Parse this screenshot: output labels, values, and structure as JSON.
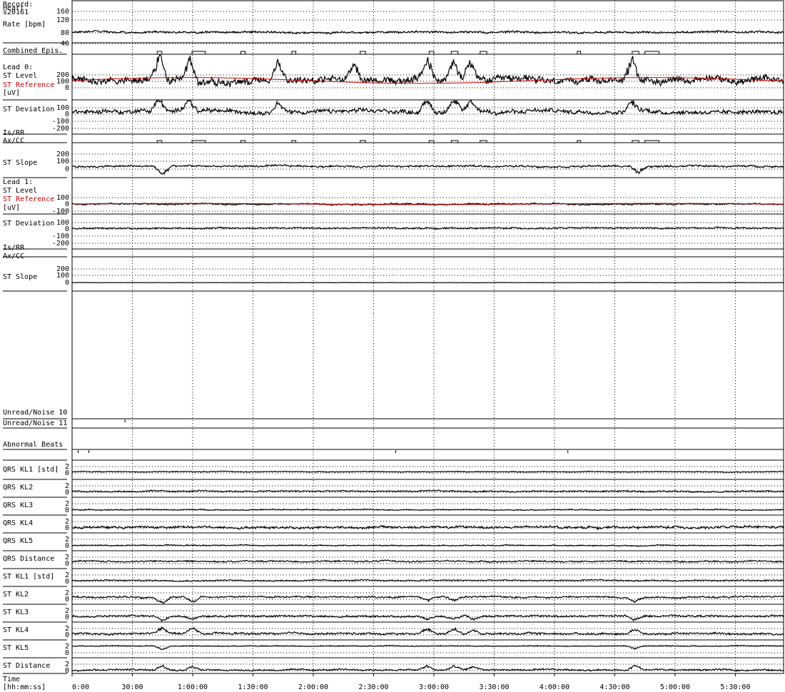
{
  "record": {
    "label": "Record:",
    "id": "s20161"
  },
  "chart_data": {
    "type": "line",
    "x_axis": {
      "label_line1": "Time",
      "label_line2": "[hh:mm:ss]",
      "range_seconds": [
        0,
        21240
      ],
      "ticks": [
        {
          "t": 0,
          "label": "0:00"
        },
        {
          "t": 1800,
          "label": "30:00"
        },
        {
          "t": 3600,
          "label": "1:00:00"
        },
        {
          "t": 5400,
          "label": "1:30:00"
        },
        {
          "t": 7200,
          "label": "2:00:00"
        },
        {
          "t": 9000,
          "label": "2:30:00"
        },
        {
          "t": 10800,
          "label": "3:00:00"
        },
        {
          "t": 12600,
          "label": "3:30:00"
        },
        {
          "t": 14400,
          "label": "4:00:00"
        },
        {
          "t": 16200,
          "label": "4:30:00"
        },
        {
          "t": 18000,
          "label": "5:00:00"
        },
        {
          "t": 19800,
          "label": "5:30:00"
        }
      ]
    },
    "panels": [
      {
        "key": "hr",
        "labels": [
          {
            "text": "Heart"
          },
          {
            "text": "Rate [bpm]"
          }
        ],
        "yticks": [
          "160",
          "120",
          "80",
          "40"
        ],
        "yrange": [
          40,
          160
        ],
        "baseline": 80,
        "amp": 6,
        "series": [
          {
            "name": "Heart Rate",
            "color": "#000000"
          }
        ]
      },
      {
        "key": "epis",
        "labels": [
          {
            "text": "Combined Epis."
          }
        ],
        "yticks": [],
        "markers": [
          [
            2540,
            2680
          ],
          [
            3580,
            3980
          ],
          [
            5040,
            5170
          ],
          [
            6560,
            6680
          ],
          [
            8600,
            8760
          ],
          [
            10660,
            10800
          ],
          [
            11320,
            11520
          ],
          [
            12180,
            12380
          ],
          [
            15080,
            15180
          ],
          [
            16720,
            16920
          ],
          [
            17100,
            17520
          ]
        ]
      },
      {
        "key": "l0level",
        "labels": [
          {
            "text": "Lead 0:"
          },
          {
            "text": "ST Level"
          },
          {
            "text": "ST Reference",
            "color": "#cc0000"
          },
          {
            "text": "[uV]"
          }
        ],
        "yticks": [
          "200",
          "100",
          "0"
        ],
        "yrange": [
          -100,
          250
        ],
        "baseline": 60,
        "amp": 45,
        "series": [
          {
            "name": "ST Level",
            "color": "#000000"
          },
          {
            "name": "ST Reference",
            "color": "#cc0000"
          }
        ],
        "spikes": [
          [
            2600,
            250
          ],
          [
            3500,
            200
          ],
          [
            6150,
            180
          ],
          [
            8400,
            170
          ],
          [
            10600,
            230
          ],
          [
            11400,
            190
          ],
          [
            11900,
            180
          ],
          [
            16700,
            220
          ]
        ]
      },
      {
        "key": "l0dev",
        "labels": [
          {
            "text": "ST Deviation"
          }
        ],
        "yticks": [
          "100",
          "0",
          "-100",
          "-200"
        ],
        "yrange": [
          -200,
          120
        ],
        "baseline": 0,
        "amp": 40,
        "series": [
          {
            "name": "ST Deviation",
            "color": "#000000"
          }
        ],
        "spikes": [
          [
            2600,
            200
          ],
          [
            3500,
            180
          ],
          [
            6150,
            140
          ],
          [
            10600,
            180
          ],
          [
            11400,
            150
          ],
          [
            11900,
            140
          ],
          [
            16700,
            160
          ]
        ]
      },
      {
        "key": "l0isrr",
        "labels": [
          {
            "text": "Is/RR"
          },
          {
            "text": "Ax/CC"
          }
        ],
        "yticks": [],
        "markers": [
          [
            2540,
            2680
          ],
          [
            3580,
            3980
          ],
          [
            5040,
            5170
          ],
          [
            6560,
            6680
          ],
          [
            8600,
            8760
          ],
          [
            10660,
            10800
          ],
          [
            11320,
            11520
          ],
          [
            12180,
            12380
          ],
          [
            15080,
            15180
          ],
          [
            16720,
            16920
          ],
          [
            17100,
            17520
          ]
        ]
      },
      {
        "key": "l0slope",
        "labels": [
          {
            "text": "ST Slope"
          }
        ],
        "yticks": [
          "200",
          "100",
          "0"
        ],
        "yrange": [
          -50,
          250
        ],
        "baseline": 80,
        "amp": 18,
        "series": [
          {
            "name": "ST Slope",
            "color": "#000000"
          }
        ],
        "spikes": [
          [
            2700,
            -120
          ],
          [
            16900,
            -100
          ]
        ]
      },
      {
        "key": "l1level",
        "labels": [
          {
            "text": "Lead 1:"
          },
          {
            "text": "ST Level"
          },
          {
            "text": "ST Reference",
            "color": "#cc0000"
          },
          {
            "text": "[uV]"
          }
        ],
        "yticks": [
          "100",
          "0",
          "-100"
        ],
        "yrange": [
          -120,
          140
        ],
        "baseline": 0,
        "amp": 18,
        "series": [
          {
            "name": "ST Level",
            "color": "#000000"
          },
          {
            "name": "ST Reference",
            "color": "#cc0000"
          }
        ]
      },
      {
        "key": "l1dev",
        "labels": [
          {
            "text": "ST Deviation"
          }
        ],
        "yticks": [
          "100",
          "0",
          "-100",
          "-200"
        ],
        "yrange": [
          -220,
          130
        ],
        "baseline": 0,
        "amp": 16,
        "series": [
          {
            "name": "ST Deviation",
            "color": "#000000"
          }
        ]
      },
      {
        "key": "l1isrr",
        "labels": [
          {
            "text": "Is/RR"
          },
          {
            "text": "Ax/CC"
          }
        ],
        "yticks": [],
        "markers": []
      },
      {
        "key": "l1slope",
        "labels": [
          {
            "text": "ST Slope"
          }
        ],
        "yticks": [
          "200",
          "100",
          "0"
        ],
        "yrange": [
          -20,
          260
        ],
        "baseline": 0,
        "amp": 3,
        "series": [
          {
            "name": "ST Slope",
            "color": "#000000"
          }
        ]
      },
      {
        "key": "empty",
        "labels": [],
        "yticks": []
      },
      {
        "key": "noise0",
        "labels": [
          {
            "text": "Unread/Noise 10"
          }
        ],
        "yticks": [],
        "ticksAt": [
          1580
        ]
      },
      {
        "key": "noise1",
        "labels": [
          {
            "text": "Unread/Noise 11"
          }
        ],
        "yticks": []
      },
      {
        "key": "abn",
        "labels": [
          {
            "text": "Abnormal Beats"
          }
        ],
        "yticks": [],
        "ticksAt": [
          180,
          500,
          9660,
          14800
        ]
      },
      {
        "key": "qkl1",
        "labels": [
          {
            "text": "QRS KL1 [std]"
          }
        ],
        "yticks": [
          "2",
          "0"
        ],
        "yrange": [
          -1,
          3
        ],
        "baseline": 0.3,
        "amp": 0.2
      },
      {
        "key": "qkl2",
        "labels": [
          {
            "text": "QRS KL2"
          }
        ],
        "yticks": [
          "2",
          "0"
        ],
        "yrange": [
          -1,
          3
        ],
        "baseline": 0.2,
        "amp": 0.35
      },
      {
        "key": "qkl3",
        "labels": [
          {
            "text": "QRS KL3"
          }
        ],
        "yticks": [
          "2",
          "0"
        ],
        "yrange": [
          -1,
          3
        ],
        "baseline": 0.0,
        "amp": 0.25
      },
      {
        "key": "qkl4",
        "labels": [
          {
            "text": "QRS KL4"
          }
        ],
        "yticks": [
          "2",
          "0"
        ],
        "yrange": [
          -1,
          3
        ],
        "baseline": 0.1,
        "amp": 0.6
      },
      {
        "key": "qkl5",
        "labels": [
          {
            "text": "QRS KL5"
          }
        ],
        "yticks": [
          "2",
          "0"
        ],
        "yrange": [
          -1,
          3
        ],
        "baseline": 0.0,
        "amp": 0.25
      },
      {
        "key": "qdist",
        "labels": [
          {
            "text": "QRS Distance"
          }
        ],
        "yticks": [
          "2",
          "0"
        ],
        "yrange": [
          -1,
          3
        ],
        "baseline": 0.6,
        "amp": 0.4
      },
      {
        "key": "skl1",
        "labels": [
          {
            "text": "ST KL1 [std]"
          }
        ],
        "yticks": [
          "2",
          "0"
        ],
        "yrange": [
          -1,
          3
        ],
        "baseline": 0.2,
        "amp": 0.3
      },
      {
        "key": "skl2",
        "labels": [
          {
            "text": "ST KL2"
          }
        ],
        "yticks": [
          "2",
          "0"
        ],
        "yrange": [
          -1,
          3
        ],
        "baseline": 0.6,
        "amp": 0.45,
        "spikes": [
          [
            2700,
            -2
          ],
          [
            3600,
            -1.8
          ],
          [
            10600,
            -1.2
          ],
          [
            11400,
            -1.3
          ],
          [
            16800,
            -1.8
          ]
        ]
      },
      {
        "key": "skl3",
        "labels": [
          {
            "text": "ST KL3"
          }
        ],
        "yticks": [
          "2",
          "0"
        ],
        "yrange": [
          -1,
          3
        ],
        "baseline": 0.2,
        "amp": 0.45,
        "spikes": [
          [
            2700,
            -1.5
          ],
          [
            3600,
            -1.2
          ],
          [
            10600,
            -1.2
          ],
          [
            11400,
            -1.3
          ],
          [
            12000,
            -1.3
          ],
          [
            16800,
            -1.5
          ]
        ]
      },
      {
        "key": "skl4",
        "labels": [
          {
            "text": "ST KL4"
          }
        ],
        "yticks": [
          "2",
          "0"
        ],
        "yrange": [
          -1,
          3
        ],
        "baseline": 0.3,
        "amp": 0.5,
        "spikes": [
          [
            2700,
            2
          ],
          [
            3600,
            2
          ],
          [
            10600,
            1.8
          ],
          [
            11400,
            1.8
          ],
          [
            12000,
            1.8
          ],
          [
            16800,
            1.8
          ]
        ]
      },
      {
        "key": "skl5",
        "labels": [
          {
            "text": "ST KL5"
          }
        ],
        "yticks": [
          "2",
          "0"
        ],
        "yrange": [
          -1,
          3
        ],
        "baseline": 2.0,
        "amp": 0.2,
        "spikes": [
          [
            2700,
            -1.5
          ],
          [
            16800,
            -1.2
          ]
        ]
      },
      {
        "key": "sdist",
        "labels": [
          {
            "text": "ST Distance"
          }
        ],
        "yticks": [
          "2",
          "0"
        ],
        "yrange": [
          -1,
          3
        ],
        "baseline": 0.1,
        "amp": 0.4,
        "spikes": [
          [
            2700,
            1.8
          ],
          [
            3600,
            1.5
          ],
          [
            10600,
            1.5
          ],
          [
            11400,
            1.3
          ],
          [
            12000,
            1.2
          ],
          [
            16800,
            1.8
          ]
        ]
      }
    ]
  }
}
